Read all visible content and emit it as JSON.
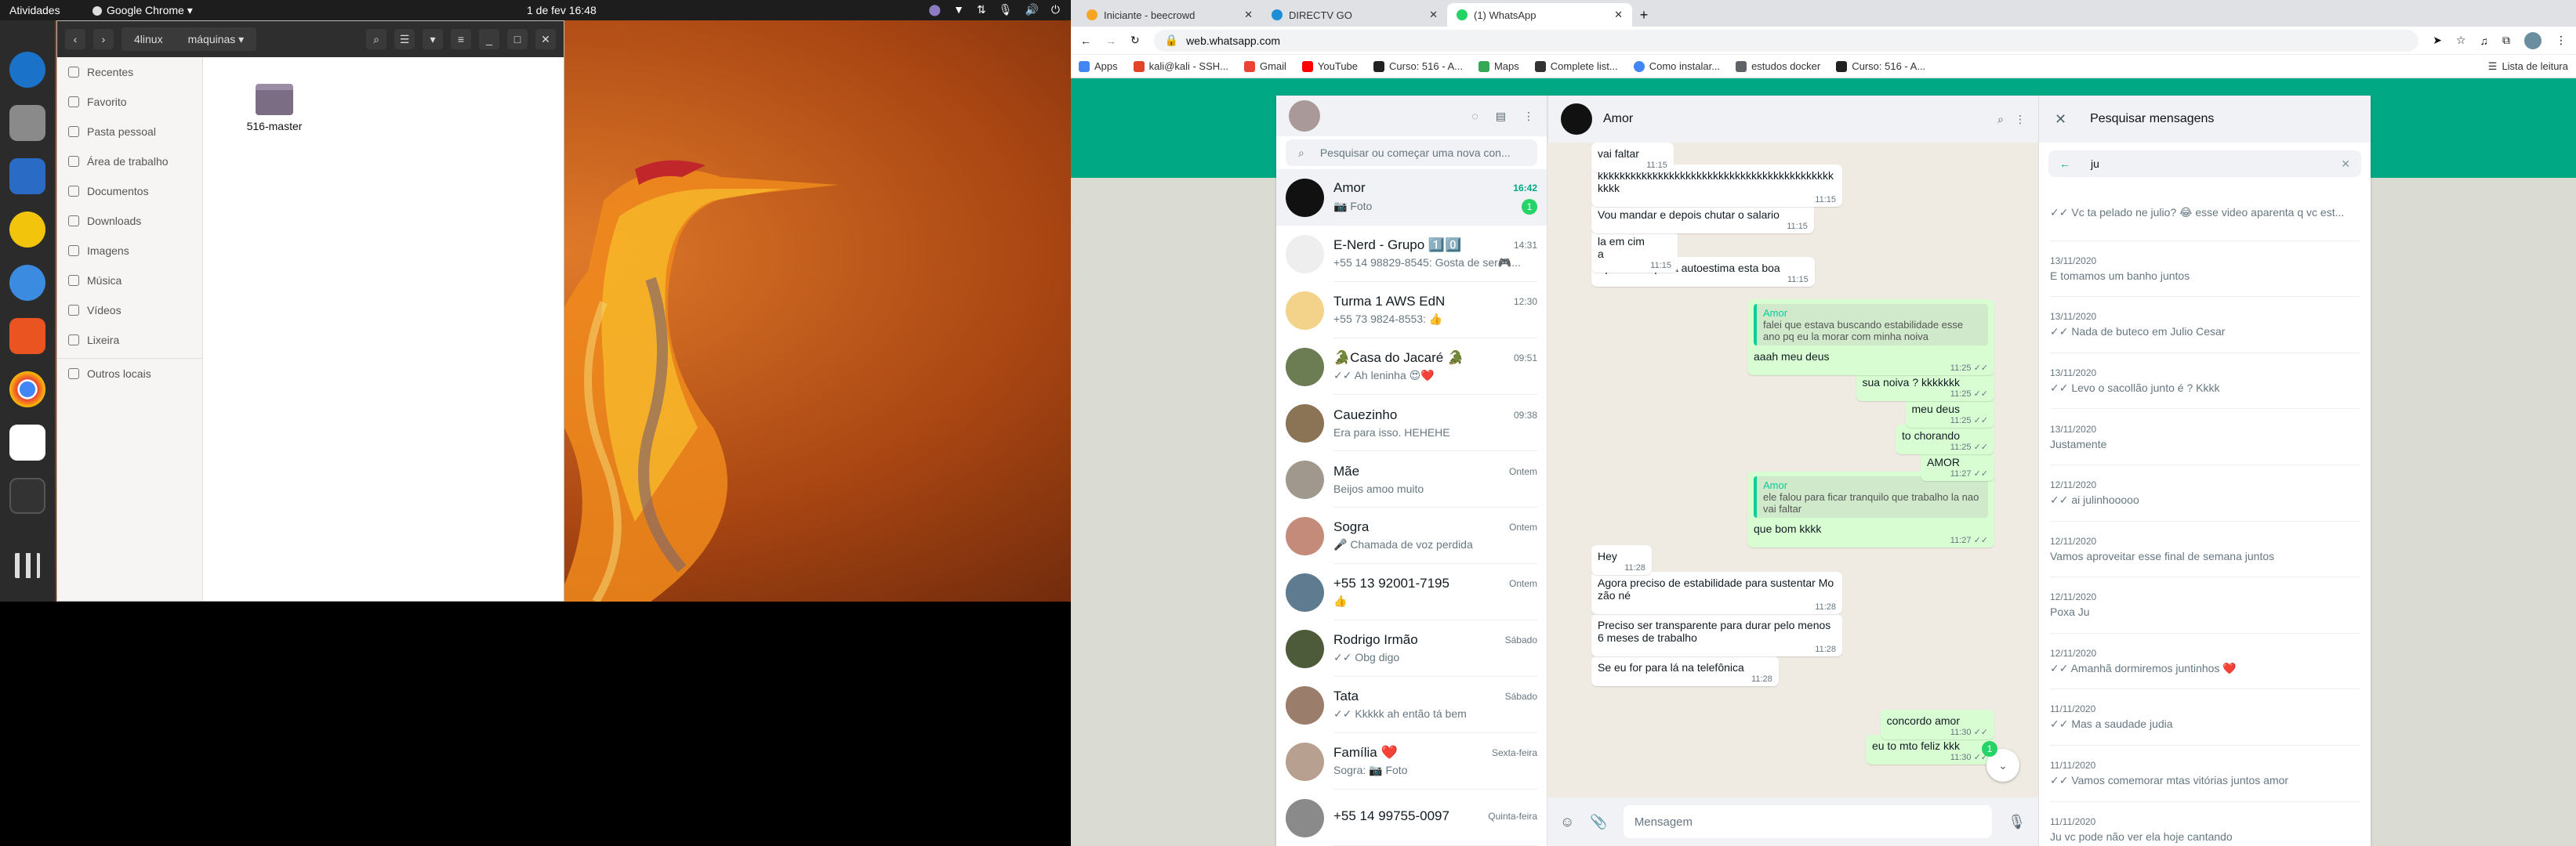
{
  "topbar": {
    "activities": "Atividades",
    "app_menu": "Google Chrome ▾",
    "clock": "1 de fev  16:48"
  },
  "files": {
    "path": [
      "4linux",
      "máquinas"
    ],
    "sidebar": [
      "Recentes",
      "Favorito",
      "Pasta pessoal",
      "Área de trabalho",
      "Documentos",
      "Downloads",
      "Imagens",
      "Música",
      "Vídeos",
      "Lixeira",
      "Outros locais"
    ],
    "folder": "516-master"
  },
  "browser": {
    "tabs": [
      "Iniciante - beecrowd",
      "DIRECTV GO",
      "(1) WhatsApp"
    ],
    "url": "web.whatsapp.com",
    "bookmarks": [
      "Apps",
      "kali@kali - SSH...",
      "Gmail",
      "YouTube",
      "Curso: 516 - A...",
      "Maps",
      "Complete list...",
      "Como instalar...",
      "estudos docker",
      "Curso: 516 - A..."
    ],
    "reading_list": "Lista de leitura"
  },
  "whatsapp": {
    "search_placeholder": "Pesquisar ou começar uma nova con...",
    "chats": [
      {
        "name": "Amor",
        "time": "16:42",
        "preview": "📷 Foto",
        "unread": "1"
      },
      {
        "name": "E-Nerd - Grupo 1️⃣0️⃣",
        "time": "14:31",
        "preview": "+55 14 98829-8545: Gosta de ser🎮...",
        "unread": ""
      },
      {
        "name": "Turma 1 AWS EdN",
        "time": "12:30",
        "preview": "+55 73 9824-8553: 👍",
        "unread": ""
      },
      {
        "name": "🐊Casa do Jacaré 🐊",
        "time": "09:51",
        "preview": "✓✓ Ah leninha 😍❤️",
        "unread": ""
      },
      {
        "name": "Cauezinho",
        "time": "09:38",
        "preview": "Era para isso. HEHEHE",
        "unread": ""
      },
      {
        "name": "Mãe",
        "time": "Ontem",
        "preview": "Beijos amoo muito",
        "unread": ""
      },
      {
        "name": "Sogra",
        "time": "Ontem",
        "preview": "🎤 Chamada de voz perdida",
        "unread": ""
      },
      {
        "name": "+55 13 92001-7195",
        "time": "Ontem",
        "preview": "👍",
        "unread": ""
      },
      {
        "name": "Rodrigo Irmão",
        "time": "Sábado",
        "preview": "✓✓ Obg digo",
        "unread": ""
      },
      {
        "name": "Tata",
        "time": "Sábado",
        "preview": "✓✓ Kkkkk ah então tá bem",
        "unread": ""
      },
      {
        "name": "Família ❤️",
        "time": "Sexta-feira",
        "preview": "Sogra: 📷 Foto",
        "unread": ""
      },
      {
        "name": "+55 14 99755-0097",
        "time": "Quinta-feira",
        "preview": "",
        "unread": ""
      }
    ],
    "conversation": {
      "name": "Amor",
      "input_placeholder": "Mensagem",
      "scroll_badge": "1",
      "messages": [
        {
          "dir": "in",
          "text": "vai faltar",
          "time": "11:15"
        },
        {
          "dir": "in",
          "text": "kkkkkkkkkkkkkkkkkkkkkkkkkkkkkkkkkkkkkkkkkkkkkkk",
          "time": "11:15"
        },
        {
          "dir": "in",
          "text": "Vou mandar e depois chutar o salario",
          "time": "11:15"
        },
        {
          "dir": "in",
          "text": "la em cima",
          "time": "11:15"
        },
        {
          "dir": "in",
          "text": "Aproveitar que a autoestima esta boa",
          "time": "11:15"
        },
        {
          "dir": "out",
          "quote_author": "Amor",
          "quote": "falei que estava buscando estabilidade esse ano pq eu la morar com minha noiva",
          "text": "aaah meu deus",
          "time": "11:25 ✓✓"
        },
        {
          "dir": "out",
          "text": "sua noiva ? kkkkkkk",
          "time": "11:25 ✓✓"
        },
        {
          "dir": "out",
          "text": "meu deus",
          "time": "11:25 ✓✓"
        },
        {
          "dir": "out",
          "text": "to chorando",
          "time": "11:25 ✓✓"
        },
        {
          "dir": "out",
          "text": "AMOR",
          "time": "11:27 ✓✓"
        },
        {
          "dir": "out",
          "quote_author": "Amor",
          "quote": "ele falou para ficar tranquilo que trabalho la nao vai faltar",
          "text": "que bom kkkk",
          "time": "11:27 ✓✓"
        },
        {
          "dir": "in",
          "text": "Hey",
          "time": "11:28"
        },
        {
          "dir": "in",
          "text": "Agora preciso de estabilidade para sustentar Mozão né",
          "time": "11:28"
        },
        {
          "dir": "in",
          "text": "Preciso ser transparente para durar pelo menos 6 meses de trabalho",
          "time": "11:28"
        },
        {
          "dir": "in",
          "text": "Se eu for para lá na telefônica",
          "time": "11:28"
        },
        {
          "dir": "out",
          "text": "concordo amor",
          "time": "11:30 ✓✓"
        },
        {
          "dir": "out",
          "text": "eu to mto feliz kkk",
          "time": "11:30 ✓✓"
        }
      ]
    },
    "search_panel": {
      "title": "Pesquisar mensagens",
      "query": "ju",
      "results": [
        {
          "date": "",
          "text": "✓✓ Vc ta pelado ne julio? 😂 esse video aparenta q vc est..."
        },
        {
          "date": "13/11/2020",
          "text": "E tomamos um banho juntos"
        },
        {
          "date": "13/11/2020",
          "text": "✓✓ Nada de buteco em Julio Cesar"
        },
        {
          "date": "13/11/2020",
          "text": "✓✓ Levo o sacollão junto é ? Kkkk"
        },
        {
          "date": "13/11/2020",
          "text": "Justamente"
        },
        {
          "date": "12/11/2020",
          "text": "✓✓ ai julinhooooo"
        },
        {
          "date": "12/11/2020",
          "text": "Vamos aproveitar esse final de semana juntos"
        },
        {
          "date": "12/11/2020",
          "text": "Poxa Ju"
        },
        {
          "date": "12/11/2020",
          "text": "✓✓ Amanhã dormiremos juntinhos ❤️"
        },
        {
          "date": "11/11/2020",
          "text": "✓✓ Mas a saudade judia"
        },
        {
          "date": "11/11/2020",
          "text": "✓✓ Vamos comemorar mtas vitórias juntos amor"
        },
        {
          "date": "11/11/2020",
          "text": "Ju vc pode não ver ela hoje cantando"
        }
      ]
    }
  }
}
